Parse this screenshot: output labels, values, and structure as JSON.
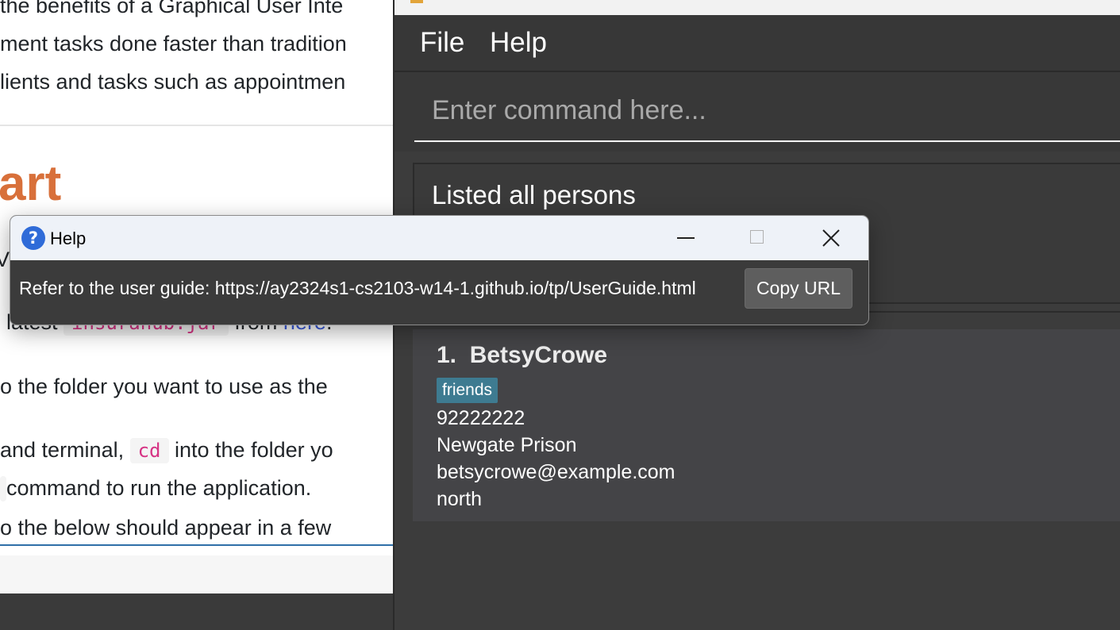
{
  "background_page": {
    "line1": "the benefits of a Graphical User Inte",
    "line2": "ment tasks done faster than tradition",
    "line3": "lients and tasks such as appointmen",
    "heading": "art",
    "line5_prefix": "latest ",
    "line5_code": "insuranub.jar",
    "line5_mid": " from ",
    "line5_link": "here",
    "line5_end": ".",
    "line6": "o the folder you want to use as the",
    "line7_prefix": "and terminal, ",
    "line7_code": "cd",
    "line7_suffix": " into the folder yo",
    "line8": " command to run the application.",
    "line9": "o the below should appear in a few",
    "cut_char": "V"
  },
  "app": {
    "menu": {
      "file": "File",
      "help": "Help"
    },
    "command_input": {
      "placeholder": "Enter command here...",
      "value": ""
    },
    "result_display": "Listed all persons",
    "persons": [
      {
        "index": "1.",
        "name": "BetsyCrowe",
        "tags": [
          "friends"
        ],
        "phone": "92222222",
        "address": "Newgate Prison",
        "email": "betsycrowe@example.com",
        "region": "north"
      }
    ],
    "colors": {
      "background": "#3c3c3c",
      "tag": "#3e7b91",
      "list": "#444447"
    }
  },
  "help_dialog": {
    "title": "Help",
    "message": "Refer to the user guide: https://ay2324s1-cs2103-w14-1.github.io/tp/UserGuide.html",
    "copy_button": "Copy URL",
    "icons": {
      "app": "help-question-icon",
      "minimize": "minimize-icon",
      "maximize": "maximize-icon",
      "close": "close-icon"
    }
  }
}
